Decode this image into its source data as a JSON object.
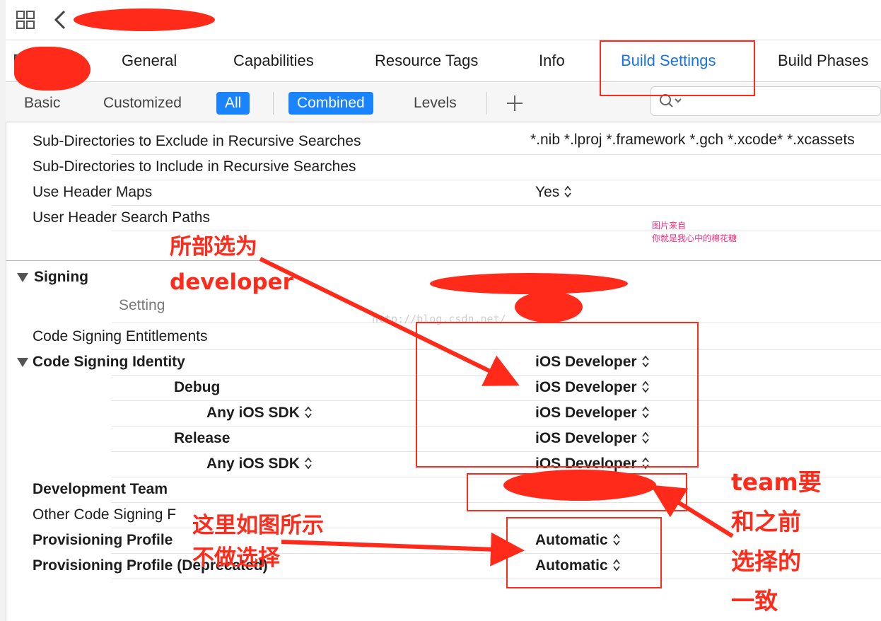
{
  "tabs": {
    "general": "General",
    "capabilities": "Capabilities",
    "resource_tags": "Resource Tags",
    "info": "Info",
    "build_settings": "Build Settings",
    "build_phases": "Build Phases"
  },
  "filters": {
    "basic": "Basic",
    "customized": "Customized",
    "all": "All",
    "combined": "Combined",
    "levels": "Levels",
    "add": "+"
  },
  "search_paths": {
    "exclude_label": "Sub-Directories to Exclude in Recursive Searches",
    "exclude_value": "*.nib *.lproj *.framework *.gch *.xcode* *.xcassets",
    "include_label": "Sub-Directories to Include in Recursive Searches",
    "header_maps_label": "Use Header Maps",
    "header_maps_value": "Yes",
    "user_header_label": "User Header Search Paths"
  },
  "signing": {
    "section": "Signing",
    "setting_col": "Setting",
    "entitlements": "Code Signing Entitlements",
    "identity": "Code Signing Identity",
    "identity_value": "iOS Developer",
    "debug": "Debug",
    "debug_value": "iOS Developer",
    "any_sdk": "Any iOS SDK",
    "debug_sdk_value": "iOS Developer",
    "release": "Release",
    "release_value": "iOS Developer",
    "release_sdk_value": "iOS Developer",
    "team": "Development Team",
    "other_flags": "Other Code Signing F",
    "profile": "Provisioning Profile",
    "profile_value": "Automatic",
    "profile_deprecated": "Provisioning Profile (Deprecated)",
    "profile_deprecated_value": "Automatic"
  },
  "annotations": {
    "note1_line1": "所部选为",
    "note1_line2": "developer",
    "note2_line1": "这里如图所示",
    "note2_line2": "不做选择",
    "note3_line1": "team要",
    "note3_line2": "和之前",
    "note3_line3": "选择的",
    "note3_line4": "一致",
    "watermark_line1": "图片来自",
    "watermark_line2": "你就是我心中的棉花糖",
    "watermark_url": "http://blog.csdn.net/"
  },
  "colors": {
    "accent": "#1a84ff",
    "annotation": "#ff2a1a"
  }
}
